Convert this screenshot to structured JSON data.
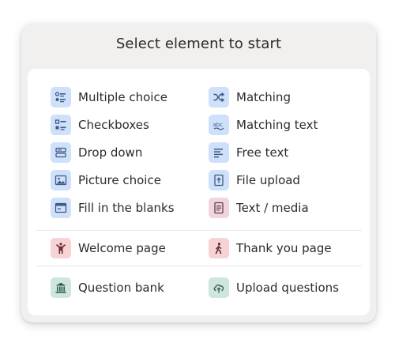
{
  "title": "Select element to start",
  "groups": {
    "left": [
      {
        "label": "Multiple choice",
        "icon": "multiple-choice-icon"
      },
      {
        "label": "Checkboxes",
        "icon": "checkboxes-icon"
      },
      {
        "label": "Drop down",
        "icon": "dropdown-icon"
      },
      {
        "label": "Picture choice",
        "icon": "picture-icon"
      },
      {
        "label": "Fill in the blanks",
        "icon": "fill-blanks-icon"
      }
    ],
    "right": [
      {
        "label": "Matching",
        "icon": "shuffle-icon"
      },
      {
        "label": "Matching text",
        "icon": "abc-icon"
      },
      {
        "label": "Free text",
        "icon": "text-lines-icon"
      },
      {
        "label": "File upload",
        "icon": "file-upload-icon"
      },
      {
        "label": "Text / media",
        "icon": "document-icon"
      }
    ]
  },
  "pages": {
    "welcome": {
      "label": "Welcome page",
      "icon": "person-welcome-icon"
    },
    "thankyou": {
      "label": "Thank you page",
      "icon": "person-walking-icon"
    }
  },
  "bank": {
    "question_bank": {
      "label": "Question bank",
      "icon": "bank-icon"
    },
    "upload_questions": {
      "label": "Upload questions",
      "icon": "cloud-upload-icon"
    }
  },
  "colors": {
    "blue_tile": "#cfe0fb",
    "pink_tile": "#f0d6dc",
    "rose_tile": "#f6d3d5",
    "green_tile": "#cfe6df",
    "icon_blue": "#3d5a80"
  }
}
